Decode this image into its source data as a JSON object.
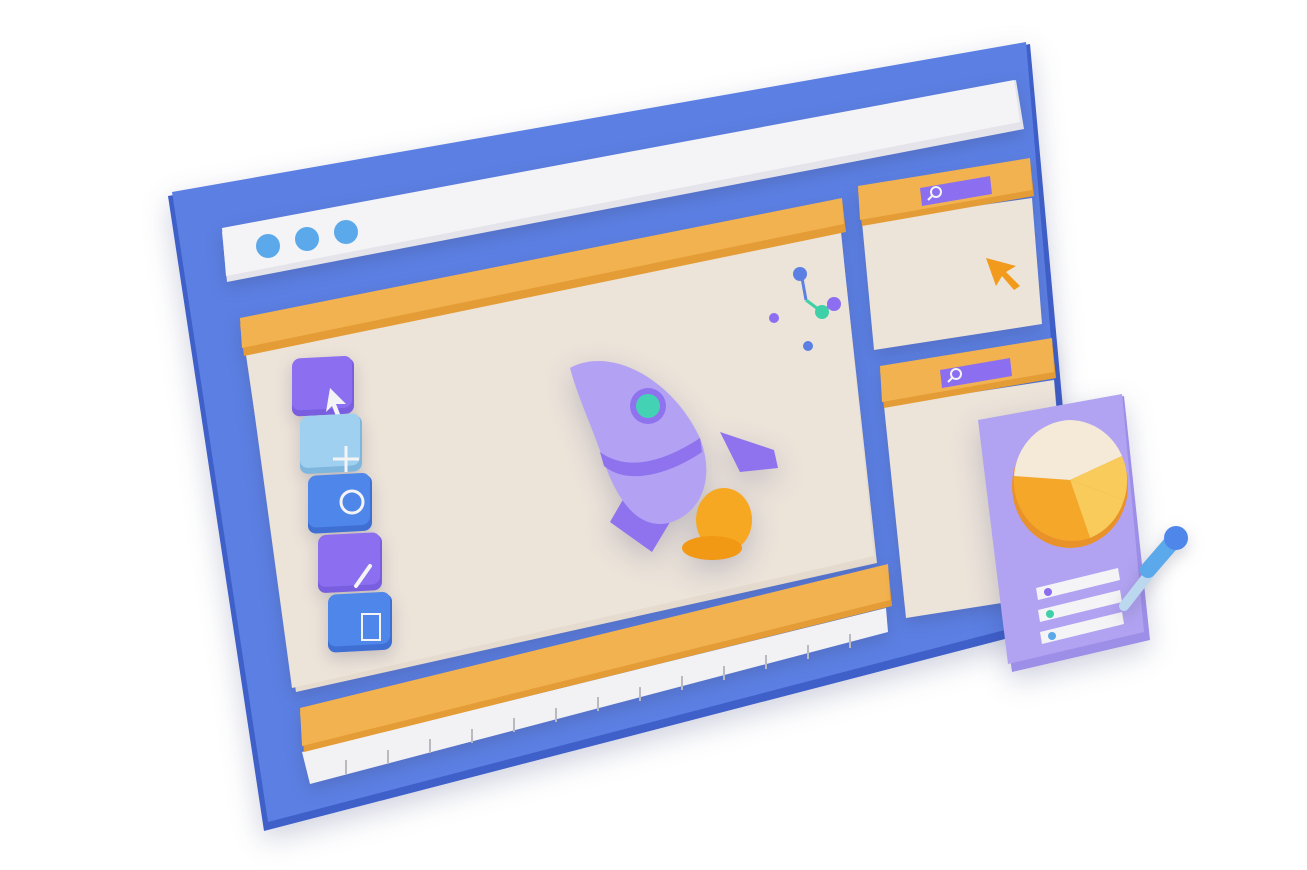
{
  "colors": {
    "frame_blue": "#5b7fe3",
    "frame_blue_dark": "#3f5fc9",
    "address_bar": "#f0f0f2",
    "panel_cream": "#ece3d9",
    "panel_header_orange": "#f2b24f",
    "search_purple": "#8c6ff1",
    "tool_purple": "#8c6ff1",
    "tool_light_blue": "#9fd0ef",
    "tool_blue": "#4f86ea",
    "rocket_lilac": "#b3a2f4",
    "rocket_purple": "#8f72ee",
    "rocket_window_teal": "#44d2b4",
    "flame_orange": "#f6a823",
    "cursor_orange": "#f29a1c",
    "card_lilac": "#b1a3f1",
    "pie_cream": "#f5ead7",
    "pie_yellow": "#f8cb5a",
    "pie_orange": "#f5a72a",
    "dot_blue": "#5ba9ea",
    "dot_teal": "#3fd0a8",
    "dot_purple": "#8d6df0"
  },
  "window": {
    "controls": [
      "dot-icon",
      "dot-icon",
      "dot-icon"
    ]
  },
  "toolbar": {
    "tools": [
      {
        "icon": "arrow-cursor-icon",
        "color": "#8c6ff1"
      },
      {
        "icon": "move-arrows-icon",
        "color": "#9fd0ef"
      },
      {
        "icon": "rotate-icon",
        "color": "#4f86ea"
      },
      {
        "icon": "pencil-icon",
        "color": "#8c6ff1"
      },
      {
        "icon": "frame-icon",
        "color": "#4f86ea"
      }
    ]
  },
  "canvas": {
    "object_icon": "rocket-icon",
    "gizmo_icon": "transform-gizmo-icon"
  },
  "side_panels": [
    {
      "search_icon": "search-icon",
      "content_icon": "cursor-arrow-icon"
    },
    {
      "search_icon": "search-icon"
    }
  ],
  "timeline": {
    "ruler_icon": "timeline-ruler"
  },
  "color_card": {
    "chart_icon": "pie-chart-icon",
    "tool_icon": "eyedropper-icon",
    "list_bullets": [
      "#8d6df0",
      "#3fd0a8",
      "#5ba9ea"
    ]
  }
}
